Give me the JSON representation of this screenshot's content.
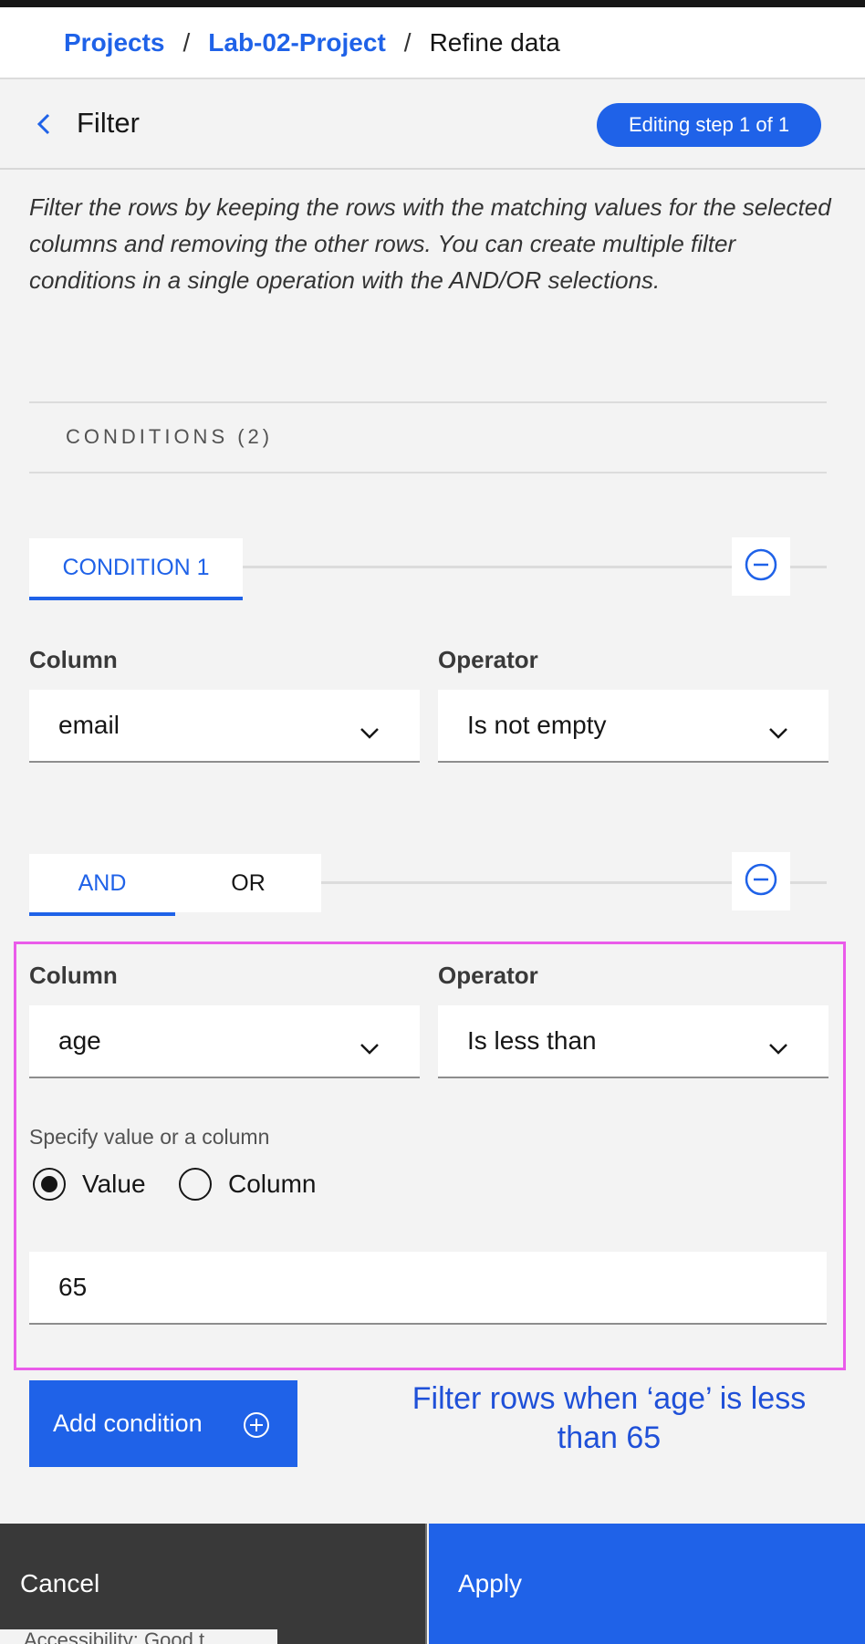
{
  "breadcrumb": {
    "items": [
      "Projects",
      "Lab-02-Project"
    ],
    "separator": "/",
    "current": "Refine data"
  },
  "header": {
    "title": "Filter",
    "step_badge": "Editing step 1 of 1"
  },
  "description": "Filter the rows by keeping the rows with the matching values for the selected columns and removing the other rows. You can create multiple filter conditions in a single operation with the AND/OR selections.",
  "conditions": {
    "header": "CONDITIONS (2)",
    "condition1": {
      "tab_label": "CONDITION 1",
      "column_label": "Column",
      "column_value": "email",
      "operator_label": "Operator",
      "operator_value": "Is not empty"
    },
    "logic": {
      "and_label": "AND",
      "or_label": "OR",
      "selected": "AND"
    },
    "condition2": {
      "column_label": "Column",
      "column_value": "age",
      "operator_label": "Operator",
      "operator_value": "Is less than",
      "specify_label": "Specify value or a column",
      "radio_value_label": "Value",
      "radio_column_label": "Column",
      "selected_radio": "Value",
      "value": "65"
    }
  },
  "add_condition_label": "Add condition",
  "annotation": "Filter rows when ‘age’ is less than 65",
  "footer": {
    "cancel_label": "Cancel",
    "apply_label": "Apply"
  },
  "peek_text": "Accessibility: Good t",
  "colors": {
    "accent": "#1f62e8",
    "highlight": "#ea5bea",
    "annotation": "#1f50d8",
    "footer_dark": "#393939"
  }
}
